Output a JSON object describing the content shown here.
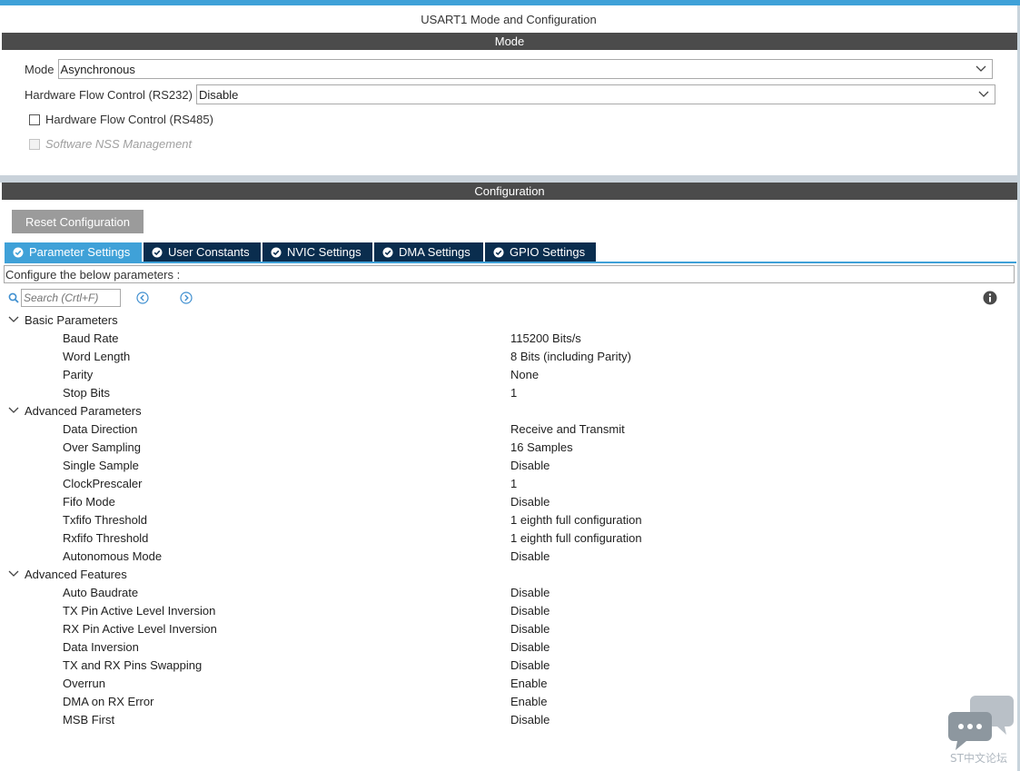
{
  "window": {
    "title": "USART1 Mode and Configuration"
  },
  "mode_section": {
    "header": "Mode",
    "mode_label": "Mode",
    "mode_value": "Asynchronous",
    "hw_flow_rs232_label": "Hardware Flow Control (RS232)",
    "hw_flow_rs232_value": "Disable",
    "hw_flow_rs485_label": "Hardware Flow Control (RS485)",
    "software_nss_label": "Software NSS Management"
  },
  "config_section": {
    "header": "Configuration",
    "reset_button": "Reset Configuration",
    "tabs": [
      {
        "label": "Parameter Settings",
        "active": true
      },
      {
        "label": "User Constants",
        "active": false
      },
      {
        "label": "NVIC Settings",
        "active": false
      },
      {
        "label": "DMA Settings",
        "active": false
      },
      {
        "label": "GPIO Settings",
        "active": false
      }
    ],
    "hint": "Configure the below parameters :",
    "search_placeholder": "Search (Crtl+F)"
  },
  "groups": [
    {
      "name": "Basic Parameters",
      "params": [
        {
          "name": "Baud Rate",
          "value": "115200 Bits/s"
        },
        {
          "name": "Word Length",
          "value": "8 Bits (including Parity)"
        },
        {
          "name": "Parity",
          "value": "None"
        },
        {
          "name": "Stop Bits",
          "value": "1"
        }
      ]
    },
    {
      "name": "Advanced Parameters",
      "params": [
        {
          "name": "Data Direction",
          "value": "Receive and Transmit"
        },
        {
          "name": "Over Sampling",
          "value": "16 Samples"
        },
        {
          "name": "Single Sample",
          "value": "Disable"
        },
        {
          "name": "ClockPrescaler",
          "value": "1"
        },
        {
          "name": "Fifo Mode",
          "value": "Disable"
        },
        {
          "name": "Txfifo Threshold",
          "value": "1 eighth full configuration"
        },
        {
          "name": "Rxfifo Threshold",
          "value": "1 eighth full configuration"
        },
        {
          "name": "Autonomous Mode",
          "value": "Disable"
        }
      ]
    },
    {
      "name": "Advanced Features",
      "params": [
        {
          "name": "Auto Baudrate",
          "value": "Disable"
        },
        {
          "name": "TX Pin Active Level Inversion",
          "value": "Disable"
        },
        {
          "name": "RX Pin Active Level Inversion",
          "value": "Disable"
        },
        {
          "name": "Data Inversion",
          "value": "Disable"
        },
        {
          "name": "TX and RX Pins Swapping",
          "value": "Disable"
        },
        {
          "name": "Overrun",
          "value": "Enable"
        },
        {
          "name": "DMA on RX Error",
          "value": "Enable"
        },
        {
          "name": "MSB First",
          "value": "Disable"
        }
      ]
    }
  ],
  "watermark": {
    "text": "ST中文论坛"
  },
  "colors": {
    "accent": "#3fa1d8",
    "tab_dark": "#0a2d4e",
    "section_bar": "#4b4b4b"
  }
}
